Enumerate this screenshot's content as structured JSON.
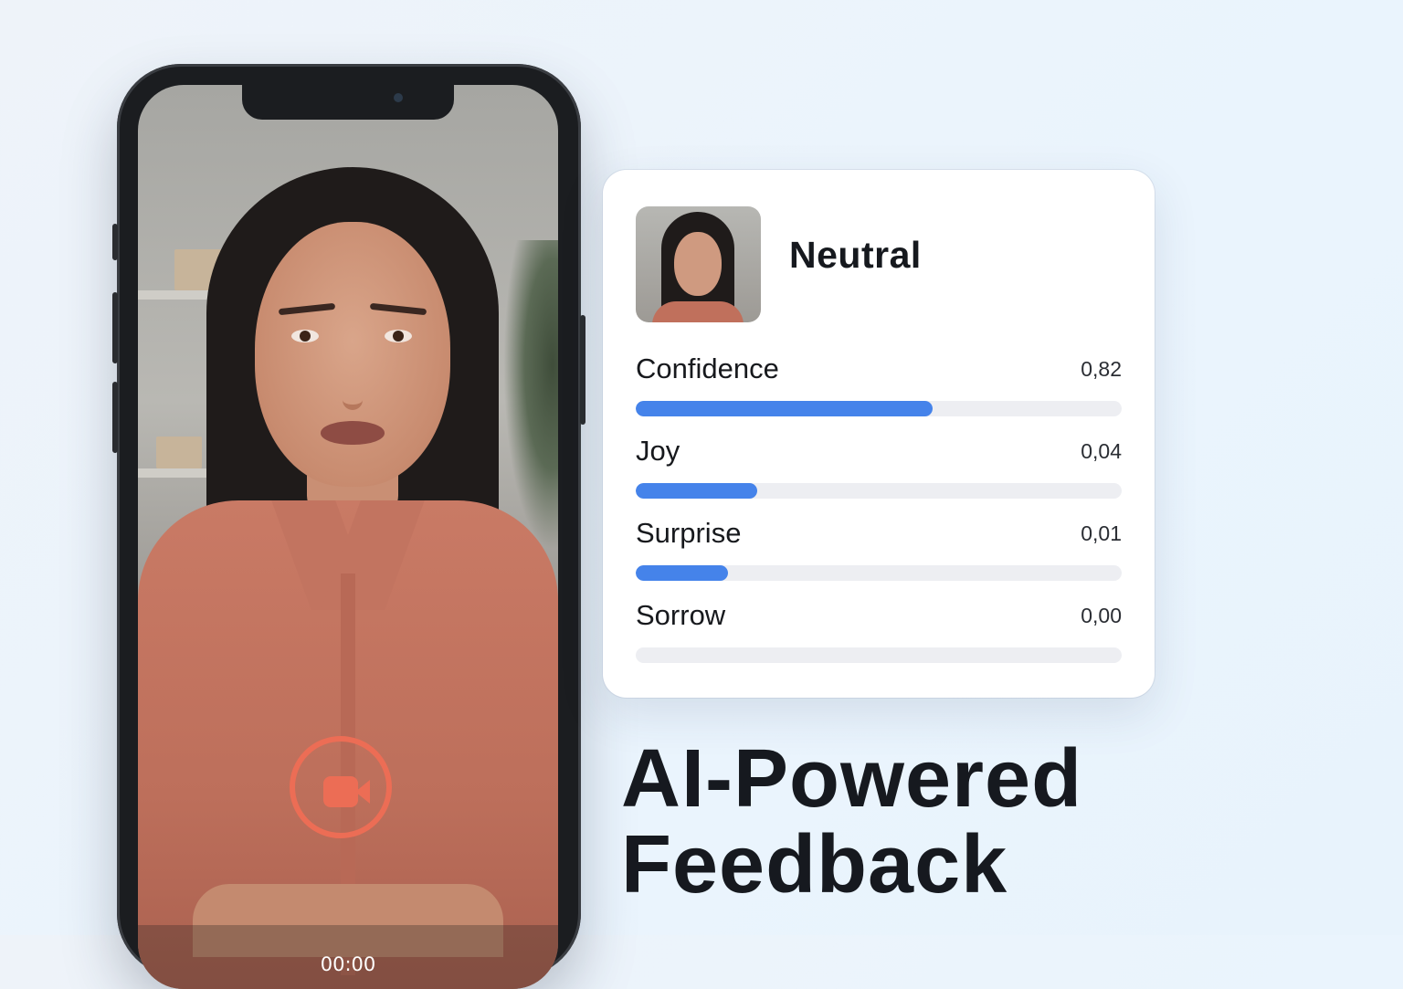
{
  "recorder": {
    "timer": "00:00",
    "record_icon": "video-camera-icon",
    "accent": "#ec6d55"
  },
  "analysis": {
    "emotion": "Neutral",
    "bar_color": "#4583ea",
    "metrics": [
      {
        "label": "Confidence",
        "value": "0,82",
        "fill": 0.61
      },
      {
        "label": "Joy",
        "value": "0,04",
        "fill": 0.25
      },
      {
        "label": "Surprise",
        "value": "0,01",
        "fill": 0.19
      },
      {
        "label": "Sorrow",
        "value": "0,00",
        "fill": 0
      }
    ]
  },
  "headline": {
    "line1": "AI-Powered",
    "line2": "Feedback"
  }
}
